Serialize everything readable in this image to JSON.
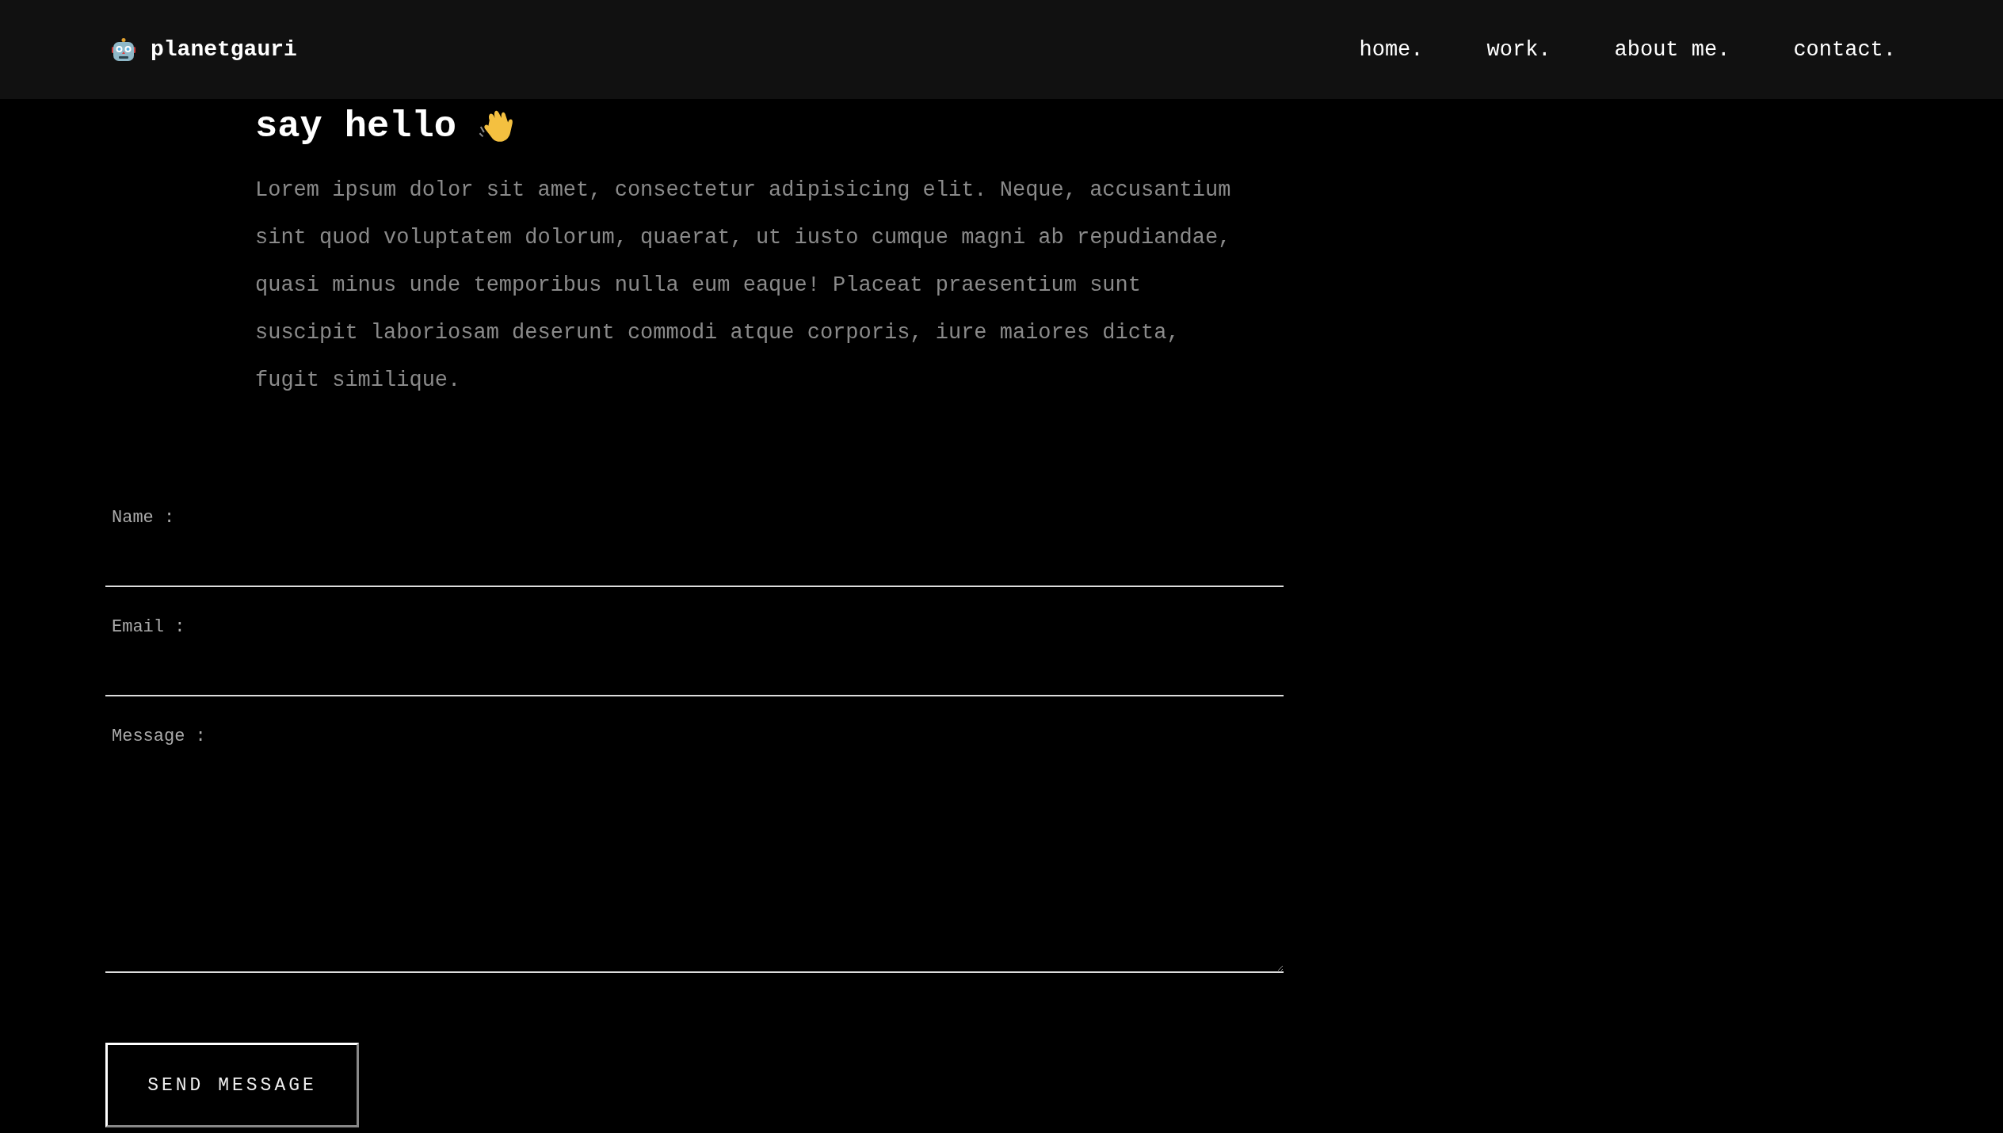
{
  "header": {
    "brand": "planetgauri",
    "nav": [
      "home.",
      "work.",
      "about me.",
      "contact."
    ]
  },
  "intro": {
    "heading": "say hello",
    "paragraph": "Lorem ipsum dolor sit amet, consectetur adipisicing elit. Neque, accusantium sint quod voluptatem dolorum, quaerat, ut iusto cumque magni ab repudiandae, quasi minus unde temporibus nulla eum eaque! Placeat praesentium sunt suscipit laboriosam deserunt commodi atque corporis, iure maiores dicta, fugit similique."
  },
  "form": {
    "fields": [
      {
        "label": "Name :",
        "kind": "line"
      },
      {
        "label": "Email :",
        "kind": "line"
      },
      {
        "label": "Message :",
        "kind": "area"
      }
    ],
    "button": "SEND MESSAGE"
  }
}
